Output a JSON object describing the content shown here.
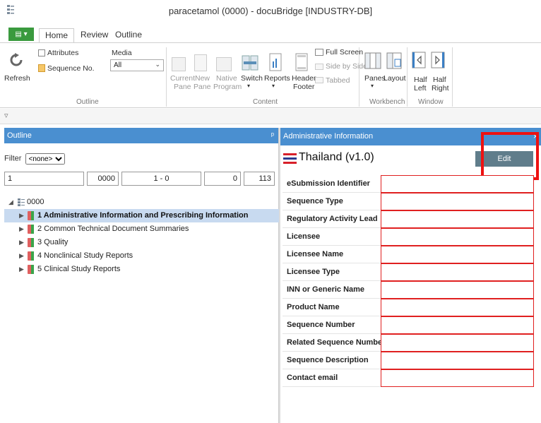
{
  "window": {
    "title": "paracetamol (0000) - docuBridge [INDUSTRY-DB]"
  },
  "tabs": {
    "file": "▤ ▾",
    "home": "Home",
    "review": "Review",
    "outline": "Outline"
  },
  "ribbon": {
    "refresh": "Refresh",
    "attributes": "Attributes",
    "sequence_no": "Sequence No.",
    "media_label": "Media",
    "media_value": "All",
    "group_outline": "Outline",
    "current_pane_1": "Current",
    "current_pane_2": "Pane",
    "new_pane_1": "New",
    "new_pane_2": "Pane",
    "native_program_1": "Native",
    "native_program_2": "Program",
    "switch": "Switch",
    "reports": "Reports",
    "header_footer_1": "Header",
    "header_footer_2": "Footer",
    "full_screen": "Full Screen",
    "side_by_side": "Side by Side",
    "tabbed": "Tabbed",
    "group_content": "Content",
    "panes": "Panes",
    "layout": "Layout",
    "group_workbench": "Workbench",
    "half_left_1": "Half",
    "half_left_2": "Left",
    "half_right_1": "Half",
    "half_right_2": "Right",
    "group_window": "Window"
  },
  "qat": {
    "arrow": "▿"
  },
  "outline_panel": {
    "title": "Outline",
    "pin": "ᵖ",
    "filter_label": "Filter",
    "filter_value": "<none>",
    "counts": [
      "1",
      "0000",
      "1 - 0",
      "0",
      "113"
    ],
    "root": "0000",
    "items": [
      "1 Administrative Information and Prescribing Information",
      "2 Common Technical Document Summaries",
      "3 Quality",
      "4 Nonclinical Study Reports",
      "5 Clinical Study Reports"
    ]
  },
  "admin_panel": {
    "title": "Administrative Information",
    "close": "×",
    "country": "Thailand (v1.0)",
    "edit": "Edit",
    "fields": [
      "eSubmission Identifier",
      "Sequence Type",
      "Regulatory Activity Lead",
      "Licensee",
      "Licensee Name",
      "Licensee Type",
      "INN or Generic Name",
      "Product Name",
      "Sequence Number",
      "Related Sequence Number",
      "Sequence Description",
      "Contact email"
    ]
  },
  "colors": {
    "accent": "#4a8fd0",
    "highlight": "#ee1111",
    "file_button": "#3a9a3e",
    "edit_button": "#607d8b"
  }
}
